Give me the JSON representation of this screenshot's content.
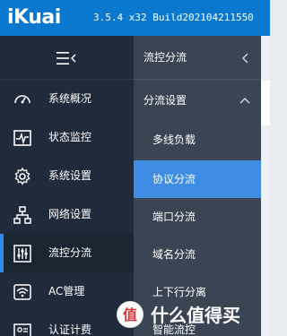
{
  "header": {
    "logo": "iKuai",
    "version": "3.5.4 x32 Build202104211550"
  },
  "left_nav": {
    "items": [
      {
        "label": "系统概况",
        "icon": "dashboard-icon"
      },
      {
        "label": "状态监控",
        "icon": "pulse-monitor-icon"
      },
      {
        "label": "系统设置",
        "icon": "gear-icon"
      },
      {
        "label": "网络设置",
        "icon": "network-tree-icon"
      },
      {
        "label": "流控分流",
        "icon": "sliders-icon",
        "active": true
      },
      {
        "label": "AC管理",
        "icon": "wifi-icon"
      },
      {
        "label": "认证计费",
        "icon": "id-card-icon"
      }
    ]
  },
  "mid_panel": {
    "title": "流控分流",
    "group": "分流设置",
    "items": [
      {
        "label": "多线负载"
      },
      {
        "label": "协议分流",
        "active": true
      },
      {
        "label": "端口分流"
      },
      {
        "label": "域名分流"
      },
      {
        "label": "上下行分离"
      },
      {
        "label": "智能流控"
      }
    ]
  },
  "watermark": {
    "text": "什么值得买"
  },
  "colors": {
    "header_blue": "#0b78cf",
    "sidebar_dark": "#1f2b3a",
    "submenu_gray": "#3a4553",
    "active_blue": "#3f8ce4"
  }
}
